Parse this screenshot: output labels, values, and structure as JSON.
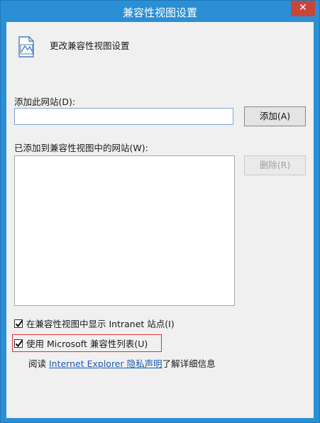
{
  "window": {
    "title": "兼容性视图设置",
    "close_glyph": "✕"
  },
  "header": {
    "icon": "document-image-icon",
    "text": "更改兼容性视图设置"
  },
  "add_site": {
    "label": "添加此网站(D):",
    "input_value": "",
    "add_button": "添加(A)"
  },
  "site_list": {
    "label": "已添加到兼容性视图中的网站(W):",
    "items": [],
    "remove_button": "删除(R)"
  },
  "options": {
    "intranet": {
      "label": "在兼容性视图中显示 Intranet 站点(I)",
      "checked": true
    },
    "ms_list": {
      "label": "使用 Microsoft 兼容性列表(U)",
      "checked": true
    }
  },
  "privacy": {
    "prefix": "阅读 ",
    "link": "Internet Explorer 隐私声明",
    "suffix": "了解详细信息"
  },
  "colors": {
    "title_bar": "#2b8fd6",
    "close_button": "#c7453a",
    "highlight_box": "#d9333a",
    "link": "#1a5fb4"
  }
}
